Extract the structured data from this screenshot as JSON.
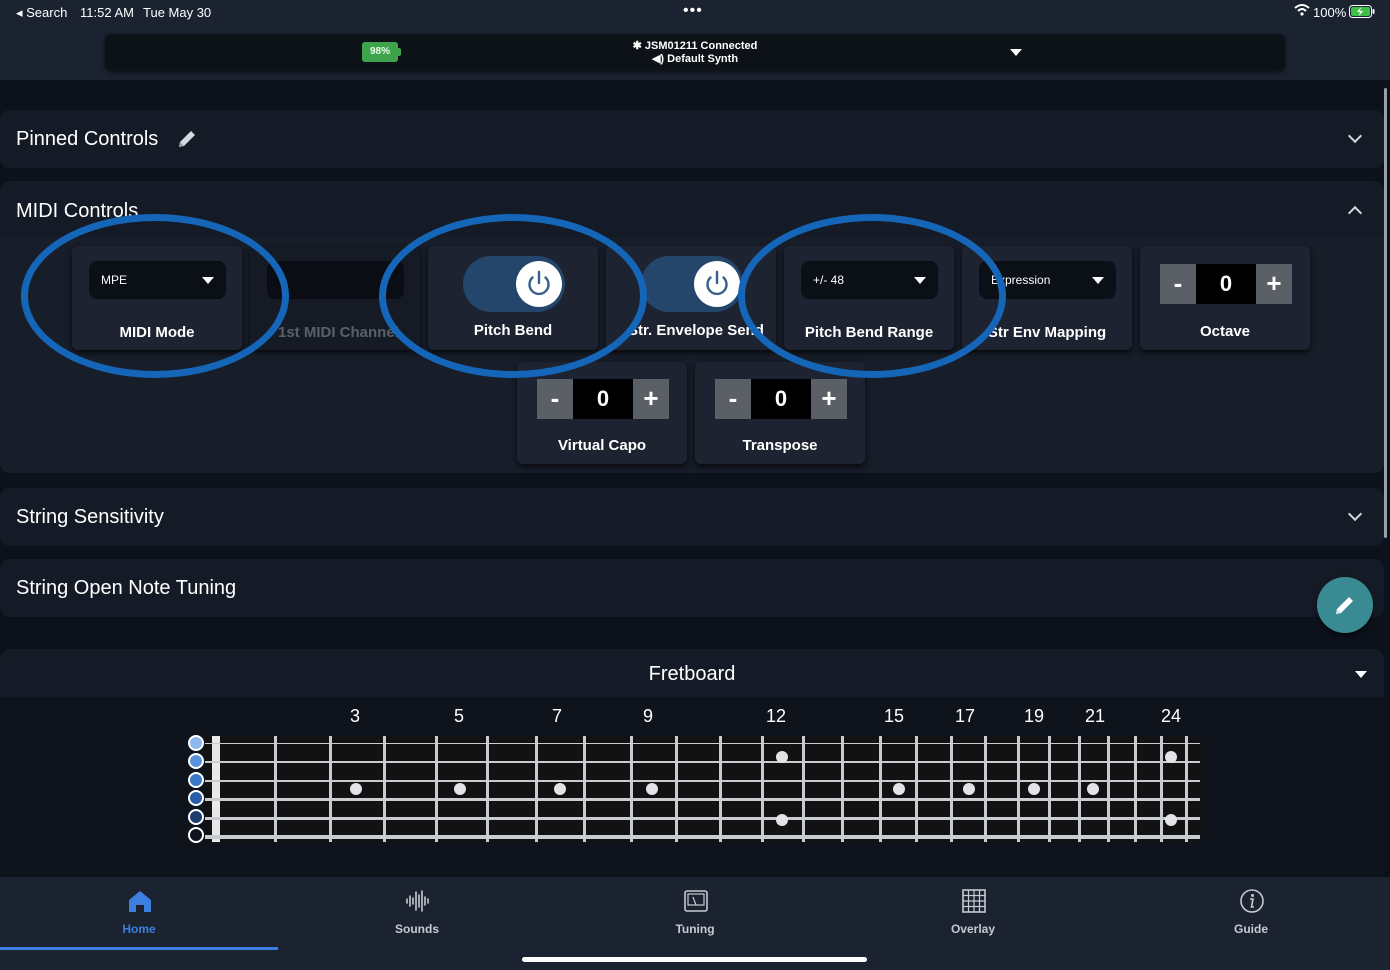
{
  "status_bar": {
    "back_label": "◂ Search",
    "time": "11:52 AM",
    "date": "Tue May 30",
    "battery": "100%"
  },
  "device_bar": {
    "battery_percent": "98%",
    "device_name": "JSM01211  Connected",
    "synth_name": "Default Synth"
  },
  "sections": {
    "pinned": {
      "title": "Pinned Controls"
    },
    "midi": {
      "title": "MIDI Controls"
    },
    "sensitivity": {
      "title": "String Sensitivity"
    },
    "tuning": {
      "title": "String Open Note Tuning"
    },
    "fretboard": {
      "title": "Fretboard"
    }
  },
  "midi_controls": {
    "midi_mode": {
      "value": "MPE",
      "label": "MIDI Mode"
    },
    "first_channel": {
      "label": "1st MIDI Channel"
    },
    "pitch_bend": {
      "label": "Pitch Bend",
      "on": true
    },
    "str_envelope": {
      "label": "Str. Envelope Send",
      "on": true
    },
    "pitch_bend_range": {
      "value": "+/- 48",
      "label": "Pitch Bend Range"
    },
    "str_env_mapping": {
      "value": "Expression",
      "label": "Str Env Mapping"
    },
    "octave": {
      "value": "0",
      "label": "Octave",
      "minus": "-",
      "plus": "+"
    },
    "virtual_capo": {
      "value": "0",
      "label": "Virtual Capo",
      "minus": "-",
      "plus": "+"
    },
    "transpose": {
      "value": "0",
      "label": "Transpose",
      "minus": "-",
      "plus": "+"
    }
  },
  "fretboard": {
    "fret_numbers": [
      "3",
      "5",
      "7",
      "9",
      "12",
      "15",
      "17",
      "19",
      "21",
      "24"
    ]
  },
  "tab_bar": {
    "tabs": [
      {
        "label": "Home",
        "icon": "home-icon",
        "active": true
      },
      {
        "label": "Sounds",
        "icon": "waveform-icon",
        "active": false
      },
      {
        "label": "Tuning",
        "icon": "tuning-icon",
        "active": false
      },
      {
        "label": "Overlay",
        "icon": "grid-icon",
        "active": false
      },
      {
        "label": "Guide",
        "icon": "info-icon",
        "active": false
      }
    ]
  },
  "colors": {
    "accent": "#3d7fe0",
    "oval": "#1566b8",
    "toggle_on": "#24466b",
    "fab": "#3a8a94",
    "battery_green": "#3fa34d"
  }
}
